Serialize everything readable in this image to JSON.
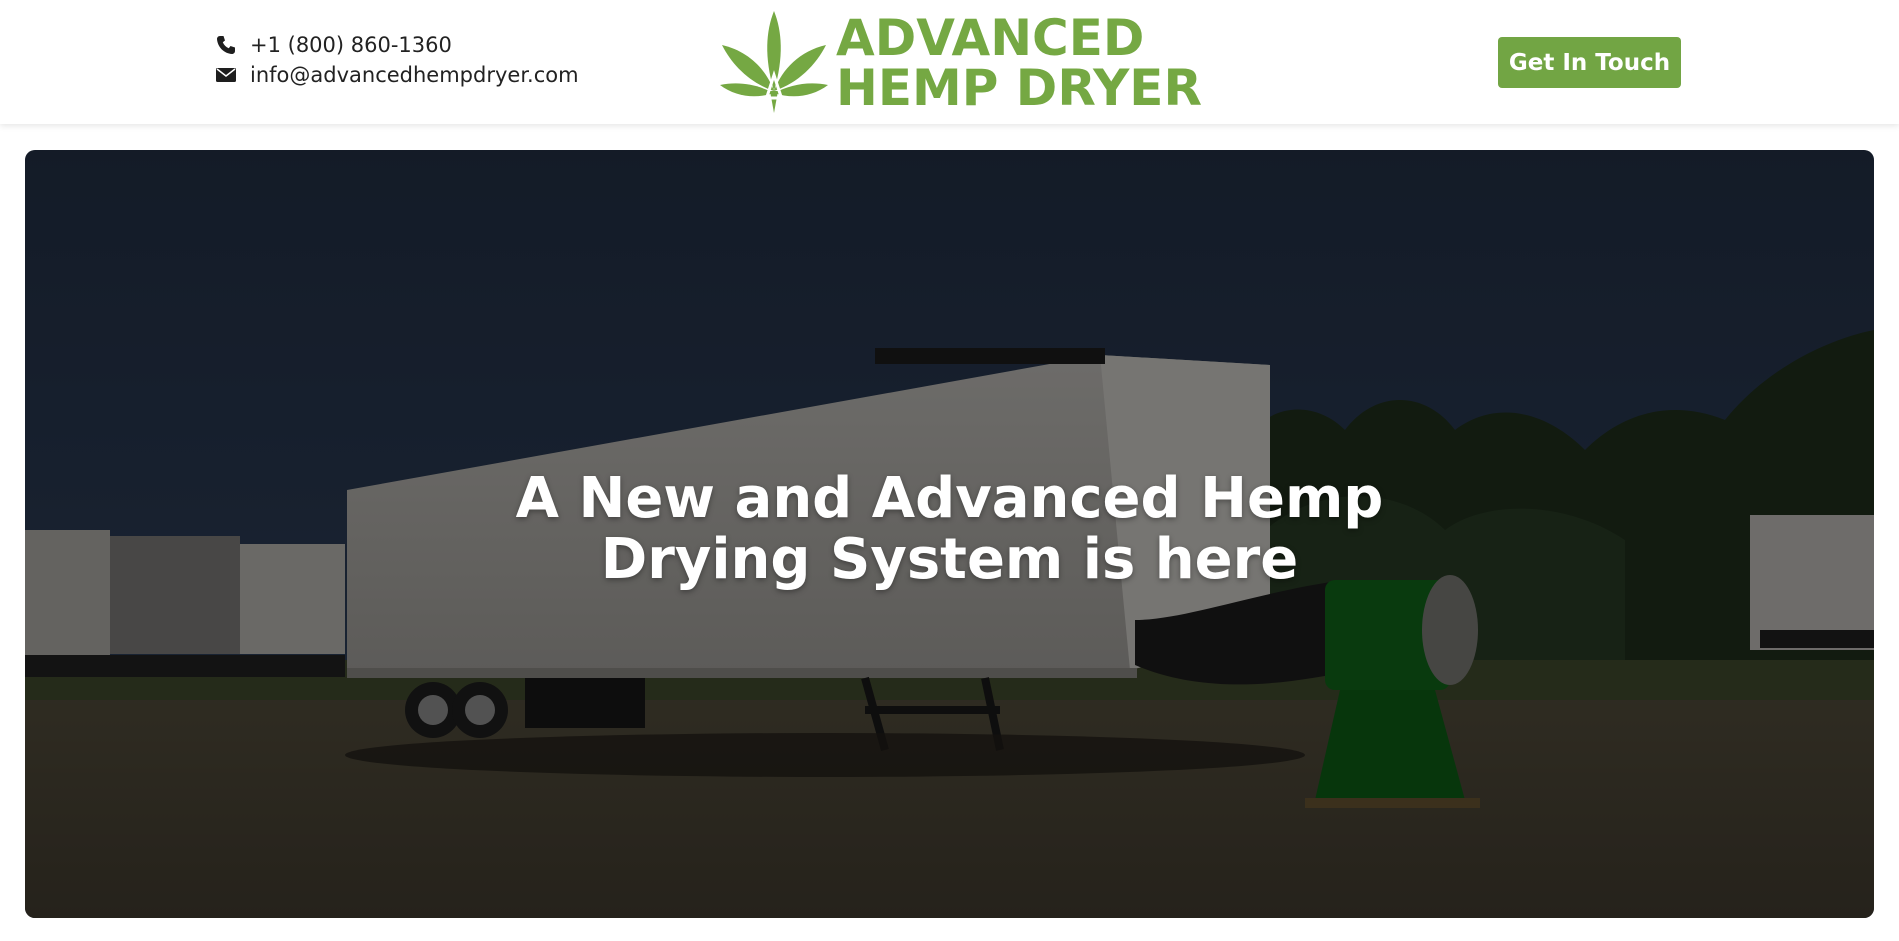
{
  "header": {
    "phone": "+1 (800) 860-1360",
    "email": "info@advancedhempdryer.com",
    "logo": {
      "line1": "ADVANCED",
      "line2": "HEMP DRYER"
    },
    "cta_label": "Get In Touch"
  },
  "hero": {
    "title_line1": "A New and Advanced Hemp",
    "title_line2": "Drying System is here"
  },
  "colors": {
    "brand_green": "#75a843",
    "button_green": "#72a544"
  },
  "icons": {
    "phone": "phone-icon",
    "email": "envelope-icon",
    "logo_mark": "hemp-leaf-icon"
  }
}
